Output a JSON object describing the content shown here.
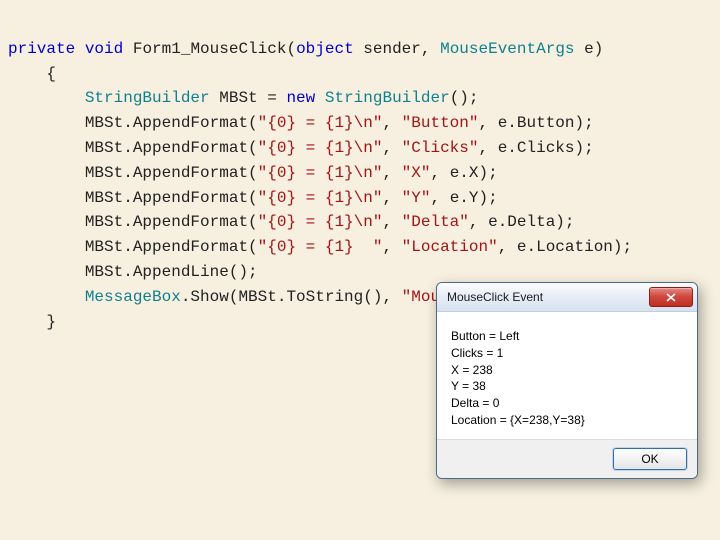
{
  "code": {
    "l1": {
      "a": "private",
      "b": "void",
      "c": " Form1_MouseClick(",
      "d": "object",
      "e": " sender, ",
      "f": "MouseEventArgs",
      "g": " e)"
    },
    "l2": "    {",
    "l3": {
      "a": "        ",
      "b": "StringBuilder",
      "c": " MBSt = ",
      "d": "new",
      "e": " ",
      "f": "StringBuilder",
      "g": "();"
    },
    "l4": {
      "a": "        MBSt.AppendFormat(",
      "s1": "\"{0} = {1}\\n\"",
      "b": ", ",
      "s2": "\"Button\"",
      "c": ", e.Button);"
    },
    "l5": {
      "a": "        MBSt.AppendFormat(",
      "s1": "\"{0} = {1}\\n\"",
      "b": ", ",
      "s2": "\"Clicks\"",
      "c": ", e.Clicks);"
    },
    "l6": {
      "a": "        MBSt.AppendFormat(",
      "s1": "\"{0} = {1}\\n\"",
      "b": ", ",
      "s2": "\"X\"",
      "c": ", e.X);"
    },
    "l7": {
      "a": "        MBSt.AppendFormat(",
      "s1": "\"{0} = {1}\\n\"",
      "b": ", ",
      "s2": "\"Y\"",
      "c": ", e.Y);"
    },
    "l8": {
      "a": "        MBSt.AppendFormat(",
      "s1": "\"{0} = {1}\\n\"",
      "b": ", ",
      "s2": "\"Delta\"",
      "c": ", e.Delta);"
    },
    "l9": {
      "a": "        MBSt.AppendFormat(",
      "s1": "\"{0} = {1}  \"",
      "b": ", ",
      "s2": "\"Location\"",
      "c": ", e.Location);"
    },
    "l10": "        MBSt.AppendLine();",
    "l11": {
      "a": "        ",
      "b": "MessageBox",
      "c": ".Show(MBSt.ToString(), ",
      "s": "\"MouseClick Event\"",
      "d": ");"
    },
    "l12": "    }"
  },
  "dialog": {
    "title": "MouseClick Event",
    "body": "Button = Left\nClicks = 1\nX = 238\nY = 38\nDelta = 0\nLocation = {X=238,Y=38}",
    "ok": "OK"
  }
}
